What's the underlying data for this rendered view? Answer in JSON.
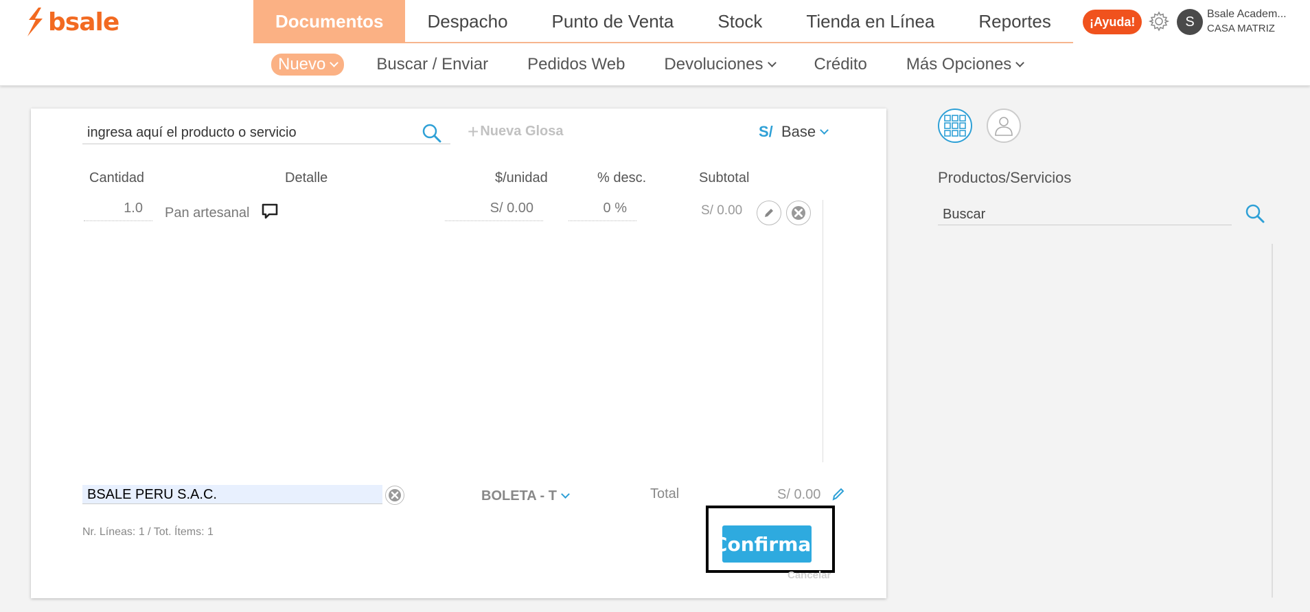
{
  "brand": {
    "name": "bsale",
    "color": "#f26a21"
  },
  "topnav": {
    "items": [
      {
        "label": "Documentos",
        "active": true
      },
      {
        "label": "Despacho"
      },
      {
        "label": "Punto de Venta"
      },
      {
        "label": "Stock"
      },
      {
        "label": "Tienda en Línea"
      },
      {
        "label": "Reportes"
      }
    ],
    "help_label": "¡Ayuda!",
    "user_initial": "S",
    "user_name": "Bsale Academ...",
    "user_branch": "CASA MATRIZ"
  },
  "subnav": {
    "items": [
      {
        "label": "Nuevo",
        "active": true,
        "dropdown": true
      },
      {
        "label": "Buscar / Enviar"
      },
      {
        "label": "Pedidos Web"
      },
      {
        "label": "Devoluciones",
        "dropdown": true
      },
      {
        "label": "Crédito"
      },
      {
        "label": "Más Opciones",
        "dropdown": true
      }
    ]
  },
  "document": {
    "search_value": "ingresa aquí el producto o servicio",
    "new_gloss_label": "Nueva Glosa",
    "currency": "S/",
    "price_list": "Base",
    "columns": [
      "Cantidad",
      "Detalle",
      "$/unidad",
      "% desc.",
      "Subtotal"
    ],
    "rows": [
      {
        "quantity": "1.0",
        "detail": "Pan artesanal",
        "unit_price": "S/ 0.00",
        "discount": "0 %",
        "subtotal": "S/ 0.00"
      }
    ],
    "client": "BSALE PERU S.A.C.",
    "doc_type": "BOLETA - T",
    "total_label": "Total",
    "total_value": "S/ 0.00",
    "line_summary": "Nr. Líneas: 1 / Tot. Ítems: 1",
    "confirm_label": "Confirmar",
    "cancel_label": "Cancelar"
  },
  "sidebar": {
    "title": "Productos/Servicios",
    "search_value": "Buscar"
  },
  "colors": {
    "accent": "#2ea0d6",
    "nav_active": "#fbb184",
    "help": "#f0521d",
    "confirm": "#2eaadf"
  }
}
